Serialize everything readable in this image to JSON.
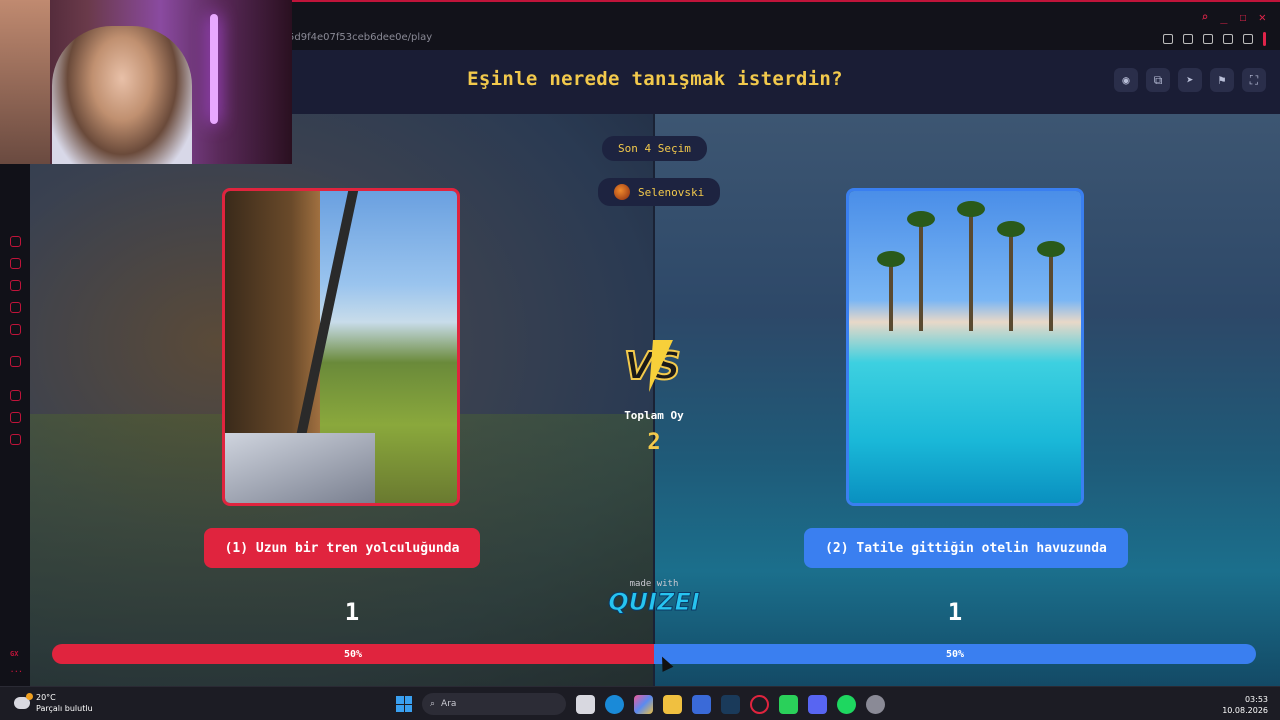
{
  "browser": {
    "url": "5d9f4e07f53ceb6dee0e/play",
    "controls": {
      "search": "search-icon",
      "minimize": "minimize-icon",
      "maximize": "maximize-icon",
      "close": "close-icon"
    }
  },
  "quiz": {
    "question": "Eşinle nerede tanışmak isterdin?",
    "header_buttons": [
      "eye-icon",
      "share-icon",
      "send-icon",
      "flag-icon",
      "fullscreen-icon"
    ],
    "stage_pill": "Son 4 Seçim",
    "user": "Selenovski",
    "total_label": "Toplam Oy",
    "total_votes": "2",
    "made_with": "made with",
    "logo": "QUIZEI",
    "vs_text": "VS",
    "left": {
      "answer": "(1) Uzun bir tren yolculuğunda",
      "votes": "1",
      "percent_label": "50%",
      "share": 0.5,
      "color": "#e0243e"
    },
    "right": {
      "answer": "(2) Tatile gittiğin otelin havuzunda",
      "votes": "1",
      "percent_label": "50%",
      "share": 0.5,
      "color": "#3a7ff0"
    }
  },
  "taskbar": {
    "weather_temp": "20°C",
    "weather_desc": "Parçalı bulutlu",
    "search_placeholder": "Ara",
    "apps": [
      "task-view-icon",
      "edge-icon",
      "copilot-icon",
      "explorer-icon",
      "store-icon",
      "steam-icon",
      "opera-gx-icon",
      "whatsapp-icon",
      "discord-icon",
      "spotify-icon",
      "settings-icon"
    ],
    "time": "03:53",
    "date": "10.08.2026"
  },
  "sidebar": {
    "gx_label": "GX",
    "more_label": "..."
  }
}
